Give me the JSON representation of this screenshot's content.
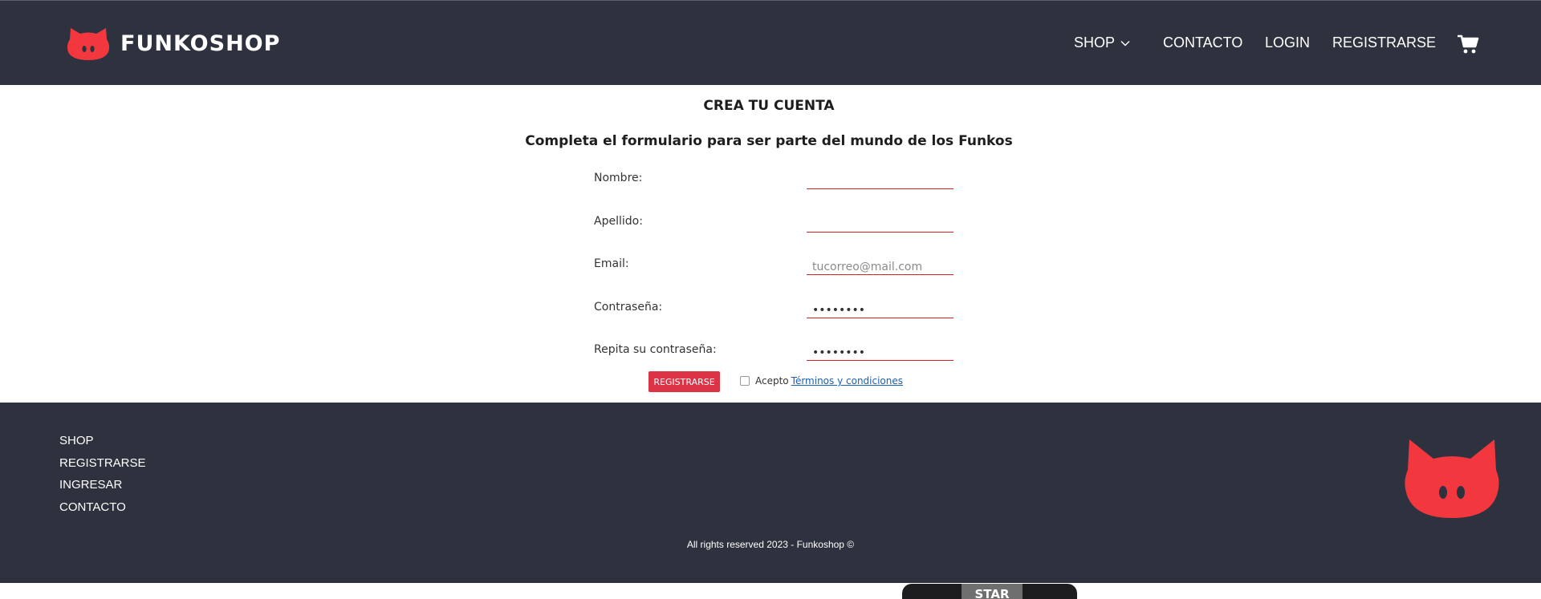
{
  "header": {
    "brand": "FUNKOSHOP",
    "nav": {
      "shop": "SHOP",
      "contact": "CONTACTO",
      "login": "LOGIN",
      "register": "REGISTRARSE"
    }
  },
  "form": {
    "title": "CREA TU CUENTA",
    "subtitle": "Completa el formulario para ser parte del mundo de los Funkos",
    "fields": [
      {
        "label": "Nombre:",
        "value": "",
        "placeholder": ""
      },
      {
        "label": "Apellido:",
        "value": "",
        "placeholder": ""
      },
      {
        "label": "Email:",
        "value": "",
        "placeholder": "tucorreo@mail.com"
      },
      {
        "label": "Contraseña:",
        "value": "••••••••",
        "placeholder": ""
      },
      {
        "label": "Repita su contraseña:",
        "value": "••••••••",
        "placeholder": ""
      }
    ],
    "submit_label": "REGISTRARSE",
    "terms_prefix": "Acepto",
    "terms_link": "Términos y condiciones",
    "terms_checked": false
  },
  "footer": {
    "links": [
      "SHOP",
      "REGISTRARSE",
      "INGRESAR",
      "CONTACTO"
    ],
    "copyright": "All rights reserved 2023 - Funkoshop ©"
  },
  "teaser": {
    "label": "STAR"
  },
  "colors": {
    "header_bg": "#2e313e",
    "brand_red": "#f2373f",
    "button_red": "#dd3346",
    "input_underline": "#d81f2a",
    "link_blue": "#1a5fb4"
  },
  "icons": {
    "logo": "funko-cat-icon",
    "dropdown": "chevron-down-icon",
    "cart": "cart-icon",
    "footer_logo": "funko-cat-icon"
  }
}
